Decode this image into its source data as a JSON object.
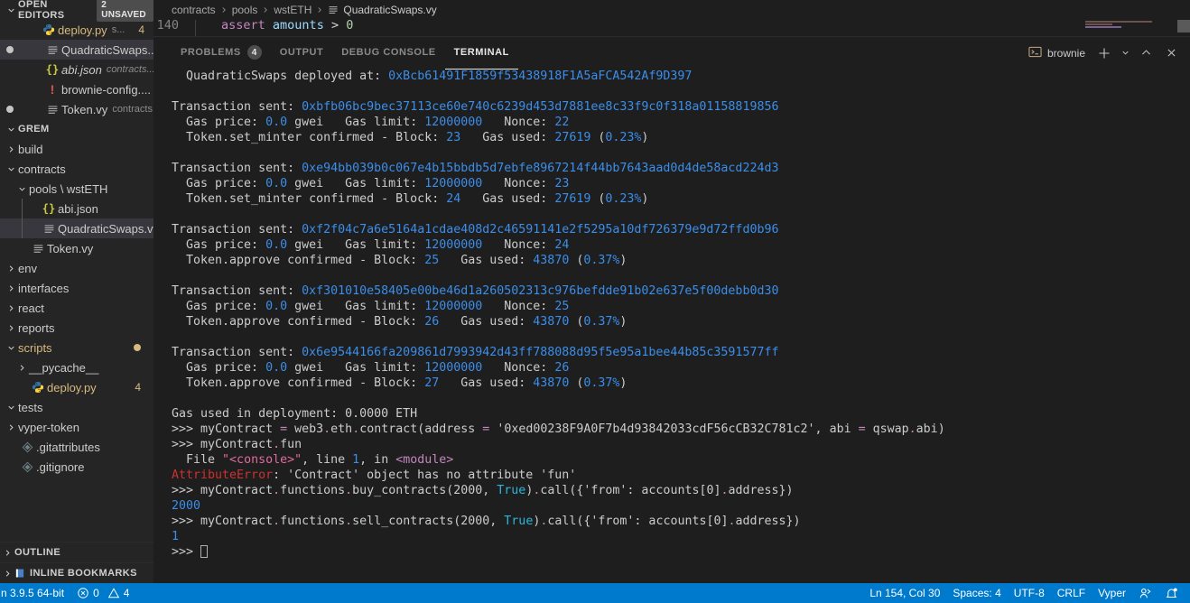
{
  "sidebar": {
    "open_editors": {
      "title": "OPEN EDITORS",
      "unsaved_badge": "2 UNSAVED",
      "items": [
        {
          "icon": "python-icon",
          "name": "deploy.py",
          "desc": "s...",
          "count": "4",
          "dirty": false,
          "selected": false,
          "style": "py"
        },
        {
          "icon": "vyper-icon",
          "name": "QuadraticSwaps....",
          "desc": "",
          "count": "",
          "dirty": true,
          "selected": true,
          "style": "main"
        },
        {
          "icon": "json-icon",
          "name": "abi.json",
          "desc": "contracts...",
          "count": "",
          "dirty": false,
          "selected": false,
          "style": "json"
        },
        {
          "icon": "warning-icon",
          "name": "brownie-config....",
          "desc": "",
          "count": "",
          "dirty": false,
          "selected": false,
          "style": "main"
        },
        {
          "icon": "vyper-icon",
          "name": "Token.vy",
          "desc": "contracts",
          "count": "",
          "dirty": true,
          "selected": false,
          "style": "main"
        }
      ]
    },
    "explorer": {
      "title": "GREM",
      "items": [
        {
          "label": "build",
          "indent": 1,
          "state": "collapsed",
          "icon": "",
          "selected": false,
          "modified": false
        },
        {
          "label": "contracts",
          "indent": 1,
          "state": "expanded",
          "icon": "",
          "selected": false,
          "modified": false
        },
        {
          "label": "pools \\ wstETH",
          "indent": 2,
          "state": "expanded",
          "icon": "",
          "selected": false,
          "modified": false
        },
        {
          "label": "abi.json",
          "indent": 3,
          "state": "leaf",
          "icon": "json-icon",
          "selected": false,
          "modified": false
        },
        {
          "label": "QuadraticSwaps.vy",
          "indent": 3,
          "state": "leaf",
          "icon": "vyper-icon",
          "selected": true,
          "modified": false
        },
        {
          "label": "Token.vy",
          "indent": 2,
          "state": "leaf",
          "icon": "vyper-icon",
          "selected": false,
          "modified": false
        },
        {
          "label": "env",
          "indent": 1,
          "state": "collapsed",
          "icon": "",
          "selected": false,
          "modified": false
        },
        {
          "label": "interfaces",
          "indent": 1,
          "state": "collapsed",
          "icon": "",
          "selected": false,
          "modified": false
        },
        {
          "label": "react",
          "indent": 1,
          "state": "collapsed",
          "icon": "",
          "selected": false,
          "modified": false
        },
        {
          "label": "reports",
          "indent": 1,
          "state": "collapsed",
          "icon": "",
          "selected": false,
          "modified": false
        },
        {
          "label": "scripts",
          "indent": 1,
          "state": "expanded",
          "icon": "",
          "selected": false,
          "modified": true,
          "style": "script"
        },
        {
          "label": "__pycache__",
          "indent": 2,
          "state": "collapsed",
          "icon": "",
          "selected": false,
          "modified": false
        },
        {
          "label": "deploy.py",
          "indent": 2,
          "state": "leaf",
          "icon": "python-icon",
          "selected": false,
          "modified": false,
          "style": "script",
          "count": "4"
        },
        {
          "label": "tests",
          "indent": 1,
          "state": "expanded",
          "icon": "",
          "selected": false,
          "modified": false
        },
        {
          "label": "vyper-token",
          "indent": 1,
          "state": "collapsed",
          "icon": "",
          "selected": false,
          "modified": false
        },
        {
          "label": ".gitattributes",
          "indent": 1,
          "state": "leaf",
          "icon": "git-icon",
          "selected": false,
          "modified": false
        },
        {
          "label": ".gitignore",
          "indent": 1,
          "state": "leaf",
          "icon": "git-icon",
          "selected": false,
          "modified": false
        }
      ]
    },
    "bottom_sections": [
      {
        "label": "OUTLINE",
        "icon": ""
      },
      {
        "label": "INLINE BOOKMARKS",
        "icon": "book-icon"
      }
    ]
  },
  "editor": {
    "breadcrumb": [
      "contracts",
      "pools",
      "wstETH",
      "QuadraticSwaps.vy"
    ],
    "breadcrumb_file_icon": "vyper-icon",
    "visible_line": {
      "number": "140",
      "keyword": "assert",
      "identifier": "amounts",
      "operator": ">",
      "value": "0"
    }
  },
  "panel": {
    "tabs": [
      {
        "label": "PROBLEMS",
        "count": "4",
        "active": false
      },
      {
        "label": "OUTPUT",
        "count": "",
        "active": false
      },
      {
        "label": "DEBUG CONSOLE",
        "count": "",
        "active": false
      },
      {
        "label": "TERMINAL",
        "count": "",
        "active": true
      }
    ],
    "terminal_name": "brownie",
    "terminal_icon": "terminal-icon",
    "actions": [
      {
        "name": "new-terminal-button",
        "glyph": "+"
      },
      {
        "name": "terminal-dropdown-button",
        "glyph": "chevron-down-icon"
      },
      {
        "name": "maximize-panel-button",
        "glyph": "chevron-up-icon"
      },
      {
        "name": "close-panel-button",
        "glyph": "close-icon"
      }
    ]
  },
  "terminal_lines": [
    {
      "segs": [
        {
          "t": "  QuadraticSwaps deployed at: ",
          "c": "t-dim"
        },
        {
          "t": "0xBcb61491F1859f53438918F1A5aFCA542Af9D397",
          "c": "t-blue"
        }
      ]
    },
    {
      "segs": []
    },
    {
      "segs": [
        {
          "t": "Transaction sent: ",
          "c": "t-dim"
        },
        {
          "t": "0xbfb06bc9bec37113ce60e740c6239d453d7881ee8c33f9c0f318a01158819856",
          "c": "t-blue"
        }
      ]
    },
    {
      "segs": [
        {
          "t": "  Gas price: ",
          "c": "t-dim"
        },
        {
          "t": "0.0",
          "c": "t-blue"
        },
        {
          "t": " gwei   Gas limit: ",
          "c": "t-dim"
        },
        {
          "t": "12000000",
          "c": "t-blue"
        },
        {
          "t": "   Nonce: ",
          "c": "t-dim"
        },
        {
          "t": "22",
          "c": "t-blue"
        }
      ]
    },
    {
      "segs": [
        {
          "t": "  Token.set_minter confirmed - Block: ",
          "c": "t-dim"
        },
        {
          "t": "23",
          "c": "t-blue"
        },
        {
          "t": "   Gas used: ",
          "c": "t-dim"
        },
        {
          "t": "27619",
          "c": "t-blue"
        },
        {
          "t": " (",
          "c": "t-dim"
        },
        {
          "t": "0.23%",
          "c": "t-blue"
        },
        {
          "t": ")",
          "c": "t-dim"
        }
      ]
    },
    {
      "segs": []
    },
    {
      "segs": [
        {
          "t": "Transaction sent: ",
          "c": "t-dim"
        },
        {
          "t": "0xe94bb039b0c067e4b15bbdb5d7ebfe8967214f44bb7643aad0d4de58acd224d3",
          "c": "t-blue"
        }
      ]
    },
    {
      "segs": [
        {
          "t": "  Gas price: ",
          "c": "t-dim"
        },
        {
          "t": "0.0",
          "c": "t-blue"
        },
        {
          "t": " gwei   Gas limit: ",
          "c": "t-dim"
        },
        {
          "t": "12000000",
          "c": "t-blue"
        },
        {
          "t": "   Nonce: ",
          "c": "t-dim"
        },
        {
          "t": "23",
          "c": "t-blue"
        }
      ]
    },
    {
      "segs": [
        {
          "t": "  Token.set_minter confirmed - Block: ",
          "c": "t-dim"
        },
        {
          "t": "24",
          "c": "t-blue"
        },
        {
          "t": "   Gas used: ",
          "c": "t-dim"
        },
        {
          "t": "27619",
          "c": "t-blue"
        },
        {
          "t": " (",
          "c": "t-dim"
        },
        {
          "t": "0.23%",
          "c": "t-blue"
        },
        {
          "t": ")",
          "c": "t-dim"
        }
      ]
    },
    {
      "segs": []
    },
    {
      "segs": [
        {
          "t": "Transaction sent: ",
          "c": "t-dim"
        },
        {
          "t": "0xf2f04c7a6e5164a1cdae408d2c46591141e2f5295a10df726379e9d72ffd0b96",
          "c": "t-blue"
        }
      ]
    },
    {
      "segs": [
        {
          "t": "  Gas price: ",
          "c": "t-dim"
        },
        {
          "t": "0.0",
          "c": "t-blue"
        },
        {
          "t": " gwei   Gas limit: ",
          "c": "t-dim"
        },
        {
          "t": "12000000",
          "c": "t-blue"
        },
        {
          "t": "   Nonce: ",
          "c": "t-dim"
        },
        {
          "t": "24",
          "c": "t-blue"
        }
      ]
    },
    {
      "segs": [
        {
          "t": "  Token.approve confirmed - Block: ",
          "c": "t-dim"
        },
        {
          "t": "25",
          "c": "t-blue"
        },
        {
          "t": "   Gas used: ",
          "c": "t-dim"
        },
        {
          "t": "43870",
          "c": "t-blue"
        },
        {
          "t": " (",
          "c": "t-dim"
        },
        {
          "t": "0.37%",
          "c": "t-blue"
        },
        {
          "t": ")",
          "c": "t-dim"
        }
      ]
    },
    {
      "segs": []
    },
    {
      "segs": [
        {
          "t": "Transaction sent: ",
          "c": "t-dim"
        },
        {
          "t": "0xf301010e58405e00be46d1a260502313c976befdde91b02e637e5f00debb0d30",
          "c": "t-blue"
        }
      ]
    },
    {
      "segs": [
        {
          "t": "  Gas price: ",
          "c": "t-dim"
        },
        {
          "t": "0.0",
          "c": "t-blue"
        },
        {
          "t": " gwei   Gas limit: ",
          "c": "t-dim"
        },
        {
          "t": "12000000",
          "c": "t-blue"
        },
        {
          "t": "   Nonce: ",
          "c": "t-dim"
        },
        {
          "t": "25",
          "c": "t-blue"
        }
      ]
    },
    {
      "segs": [
        {
          "t": "  Token.approve confirmed - Block: ",
          "c": "t-dim"
        },
        {
          "t": "26",
          "c": "t-blue"
        },
        {
          "t": "   Gas used: ",
          "c": "t-dim"
        },
        {
          "t": "43870",
          "c": "t-blue"
        },
        {
          "t": " (",
          "c": "t-dim"
        },
        {
          "t": "0.37%",
          "c": "t-blue"
        },
        {
          "t": ")",
          "c": "t-dim"
        }
      ]
    },
    {
      "segs": []
    },
    {
      "segs": [
        {
          "t": "Transaction sent: ",
          "c": "t-dim"
        },
        {
          "t": "0x6e9544166fa209861d7993942d43ff788088d95f5e95a1bee44b85c3591577ff",
          "c": "t-blue"
        }
      ]
    },
    {
      "segs": [
        {
          "t": "  Gas price: ",
          "c": "t-dim"
        },
        {
          "t": "0.0",
          "c": "t-blue"
        },
        {
          "t": " gwei   Gas limit: ",
          "c": "t-dim"
        },
        {
          "t": "12000000",
          "c": "t-blue"
        },
        {
          "t": "   Nonce: ",
          "c": "t-dim"
        },
        {
          "t": "26",
          "c": "t-blue"
        }
      ]
    },
    {
      "segs": [
        {
          "t": "  Token.approve confirmed - Block: ",
          "c": "t-dim"
        },
        {
          "t": "27",
          "c": "t-blue"
        },
        {
          "t": "   Gas used: ",
          "c": "t-dim"
        },
        {
          "t": "43870",
          "c": "t-blue"
        },
        {
          "t": " (",
          "c": "t-dim"
        },
        {
          "t": "0.37%",
          "c": "t-blue"
        },
        {
          "t": ")",
          "c": "t-dim"
        }
      ]
    },
    {
      "segs": []
    },
    {
      "segs": [
        {
          "t": "Gas used in deployment: 0.0000 ETH",
          "c": "t-dim"
        }
      ]
    },
    {
      "segs": [
        {
          "t": ">>> myContract ",
          "c": "t-dim"
        },
        {
          "t": "=",
          "c": "t-mag"
        },
        {
          "t": " web3",
          "c": "t-dim"
        },
        {
          "t": ".",
          "c": "t-mag"
        },
        {
          "t": "eth",
          "c": "t-dim"
        },
        {
          "t": ".",
          "c": "t-mag"
        },
        {
          "t": "contract(address ",
          "c": "t-dim"
        },
        {
          "t": "=",
          "c": "t-mag"
        },
        {
          "t": " '0xed00238F9A0F7b4d93842033cdF56cCB32C781c2', abi ",
          "c": "t-dim"
        },
        {
          "t": "=",
          "c": "t-mag"
        },
        {
          "t": " qswap",
          "c": "t-dim"
        },
        {
          "t": ".",
          "c": "t-mag"
        },
        {
          "t": "abi)",
          "c": "t-dim"
        }
      ]
    },
    {
      "segs": [
        {
          "t": ">>> myContract",
          "c": "t-dim"
        },
        {
          "t": ".",
          "c": "t-mag"
        },
        {
          "t": "fun",
          "c": "t-dim"
        }
      ]
    },
    {
      "segs": [
        {
          "t": "  File ",
          "c": "t-dim"
        },
        {
          "t": "\"<console>\"",
          "c": "t-pink"
        },
        {
          "t": ", line ",
          "c": "t-dim"
        },
        {
          "t": "1",
          "c": "t-blue"
        },
        {
          "t": ", in ",
          "c": "t-dim"
        },
        {
          "t": "<module>",
          "c": "t-mag"
        }
      ]
    },
    {
      "segs": [
        {
          "t": "AttributeError",
          "c": "t-red"
        },
        {
          "t": ": 'Contract' object has no attribute 'fun'",
          "c": "t-dim"
        }
      ]
    },
    {
      "segs": [
        {
          "t": ">>> myContract",
          "c": "t-dim"
        },
        {
          "t": ".",
          "c": "t-mag"
        },
        {
          "t": "functions",
          "c": "t-dim"
        },
        {
          "t": ".",
          "c": "t-mag"
        },
        {
          "t": "buy_contracts(2000, ",
          "c": "t-dim"
        },
        {
          "t": "True",
          "c": "t-cyan"
        },
        {
          "t": ")",
          "c": "t-dim"
        },
        {
          "t": ".",
          "c": "t-mag"
        },
        {
          "t": "call({'from': accounts[0]",
          "c": "t-dim"
        },
        {
          "t": ".",
          "c": "t-mag"
        },
        {
          "t": "address})",
          "c": "t-dim"
        }
      ]
    },
    {
      "segs": [
        {
          "t": "2000",
          "c": "t-blue"
        }
      ]
    },
    {
      "segs": [
        {
          "t": ">>> myContract",
          "c": "t-dim"
        },
        {
          "t": ".",
          "c": "t-mag"
        },
        {
          "t": "functions",
          "c": "t-dim"
        },
        {
          "t": ".",
          "c": "t-mag"
        },
        {
          "t": "sell_contracts(2000, ",
          "c": "t-dim"
        },
        {
          "t": "True",
          "c": "t-cyan"
        },
        {
          "t": ")",
          "c": "t-dim"
        },
        {
          "t": ".",
          "c": "t-mag"
        },
        {
          "t": "call({'from': accounts[0]",
          "c": "t-dim"
        },
        {
          "t": ".",
          "c": "t-mag"
        },
        {
          "t": "address})",
          "c": "t-dim"
        }
      ]
    },
    {
      "segs": [
        {
          "t": "1",
          "c": "t-blue"
        }
      ]
    },
    {
      "segs": [
        {
          "t": ">>> ",
          "c": "t-dim"
        },
        {
          "t": "__CURSOR__",
          "c": "cursor"
        }
      ]
    }
  ],
  "statusbar": {
    "left": [
      {
        "name": "python-version",
        "label": "n 3.9.5 64-bit"
      },
      {
        "name": "problems-status",
        "label": "0",
        "label2": "4",
        "icon": "error-icon",
        "icon2": "warning-icon"
      }
    ],
    "right": [
      {
        "name": "cursor-position",
        "label": "Ln 154, Col 30"
      },
      {
        "name": "indentation",
        "label": "Spaces: 4"
      },
      {
        "name": "encoding",
        "label": "UTF-8"
      },
      {
        "name": "line-endings",
        "label": "CRLF"
      },
      {
        "name": "language-mode",
        "label": "Vyper"
      },
      {
        "name": "live-share-icon",
        "label": ""
      },
      {
        "name": "notifications-bell-icon",
        "label": ""
      }
    ]
  }
}
